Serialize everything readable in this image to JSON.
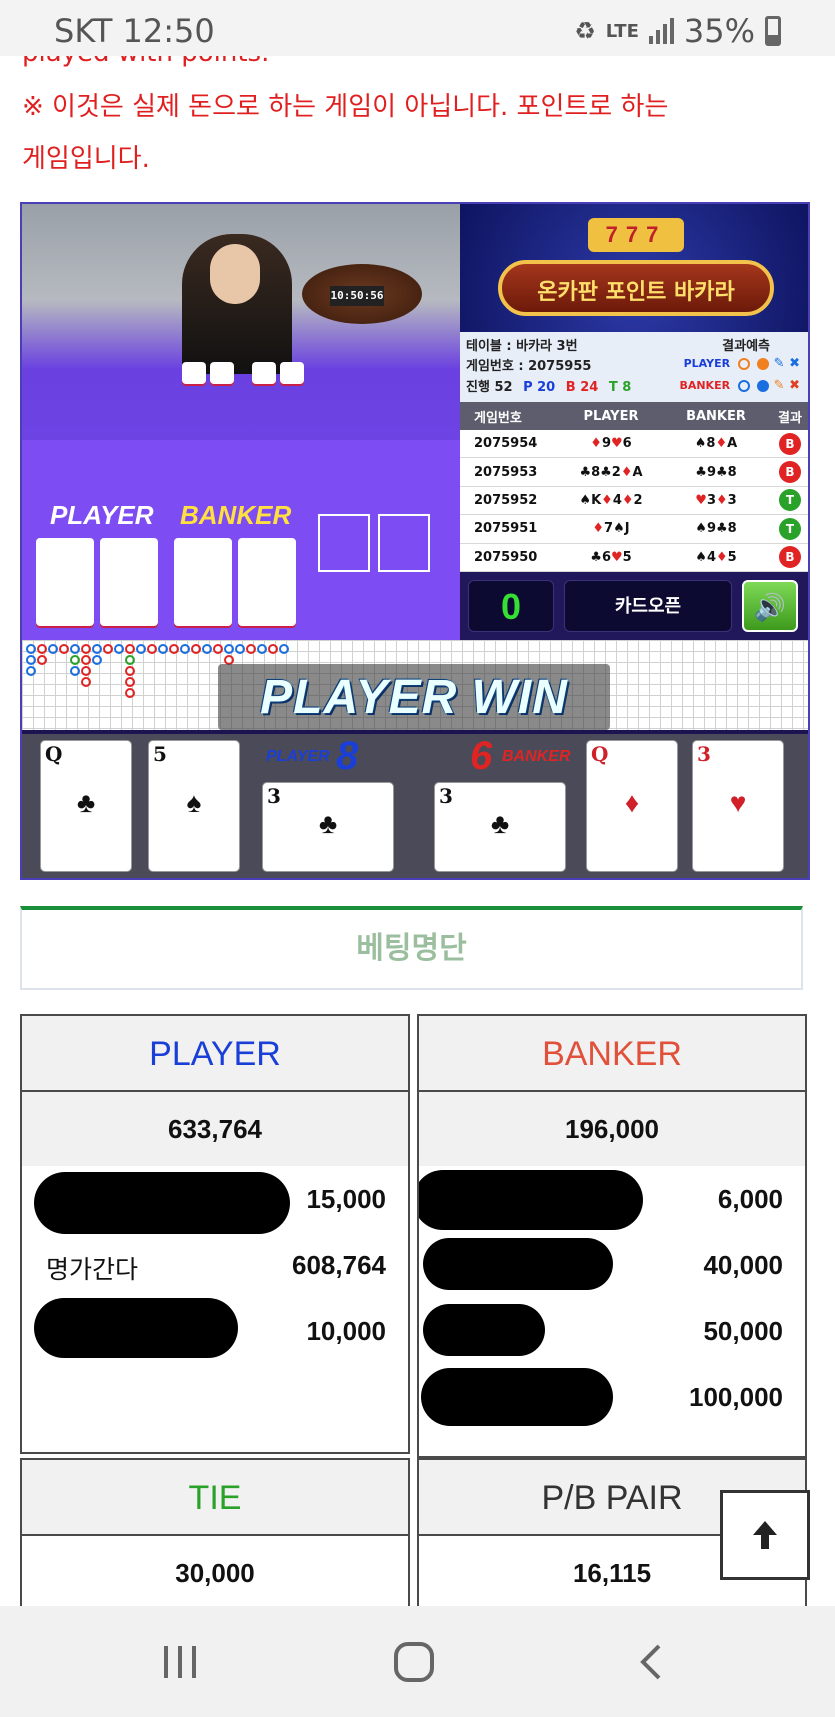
{
  "status_bar": {
    "carrier": "SKT",
    "time": "12:50",
    "network": "LTE",
    "battery": "35%"
  },
  "notice": {
    "line_cut": "played with points.",
    "line1": "※ 이것은 실제 돈으로 하는 게임이 아닙니다. 포인트로 하는",
    "line2": "게임입니다."
  },
  "game": {
    "clock": "10:50:56",
    "table_player_label": "PLAYER",
    "table_banker_label": "BANKER",
    "banner_title": "온카판 포인트 바카라",
    "banner_slot": "777",
    "info": {
      "table": "테이블 : 바카라 3번",
      "game_no": "게임번호 : 2075955",
      "progress_label": "진행 52",
      "progress_p": "P 20",
      "progress_b": "B 24",
      "progress_t": "T 8",
      "prediction_label": "결과예측",
      "pred_player": "PLAYER",
      "pred_banker": "BANKER"
    },
    "history": {
      "headers": [
        "게임번호",
        "PLAYER",
        "BANKER",
        "결과"
      ],
      "rows": [
        {
          "no": "2075954",
          "player": "♦9♥6",
          "banker": "♠8♦A",
          "result": "B"
        },
        {
          "no": "2075953",
          "player": "♣8♣2♦A",
          "banker": "♣9♣8",
          "result": "B"
        },
        {
          "no": "2075952",
          "player": "♠K♦4♦2",
          "banker": "♥3♦3",
          "result": "T"
        },
        {
          "no": "2075951",
          "player": "♦7♠J",
          "banker": "♠9♣8",
          "result": "T"
        },
        {
          "no": "2075950",
          "player": "♣6♥5",
          "banker": "♠4♦5",
          "result": "B"
        }
      ]
    },
    "count": "0",
    "card_open_label": "카드오픈",
    "sound_icon": "speaker-icon",
    "win_text": "PLAYER WIN",
    "player_label": "PLAYER",
    "player_score": "8",
    "banker_label": "BANKER",
    "banker_score": "6",
    "player_cards": [
      {
        "rank": "Q",
        "suit": "♣",
        "color": "#111"
      },
      {
        "rank": "5",
        "suit": "♠",
        "color": "#111"
      },
      {
        "rank": "3",
        "suit": "♣",
        "color": "#111"
      }
    ],
    "banker_cards": [
      {
        "rank": "3",
        "suit": "♣",
        "color": "#111"
      },
      {
        "rank": "Q",
        "suit": "♦",
        "color": "#d0202a"
      },
      {
        "rank": "3",
        "suit": "♥",
        "color": "#d0202a"
      }
    ],
    "colors": {
      "player": "#1a3fd8",
      "banker": "#e02424",
      "tie": "#2aa22a"
    }
  },
  "betting": {
    "header": "베팅명단",
    "player": {
      "title": "PLAYER",
      "total": "633,764",
      "rows": [
        {
          "name": "",
          "amount": "15,000"
        },
        {
          "name": "명가간다",
          "amount": "608,764"
        },
        {
          "name": "",
          "amount": "10,000"
        }
      ]
    },
    "banker": {
      "title": "BANKER",
      "total": "196,000",
      "rows": [
        {
          "name": "",
          "amount": "6,000"
        },
        {
          "name": "",
          "amount": "40,000"
        },
        {
          "name": "",
          "amount": "50,000"
        },
        {
          "name": "",
          "amount": "100,000"
        }
      ]
    },
    "tie": {
      "title": "TIE",
      "total": "30,000"
    },
    "pair": {
      "title": "P/B PAIR",
      "total": "16,115"
    }
  },
  "scroll_top_icon": "arrow-up-icon",
  "nav": {
    "recents_icon": "recents-icon",
    "home_icon": "home-icon",
    "back_icon": "back-icon"
  }
}
